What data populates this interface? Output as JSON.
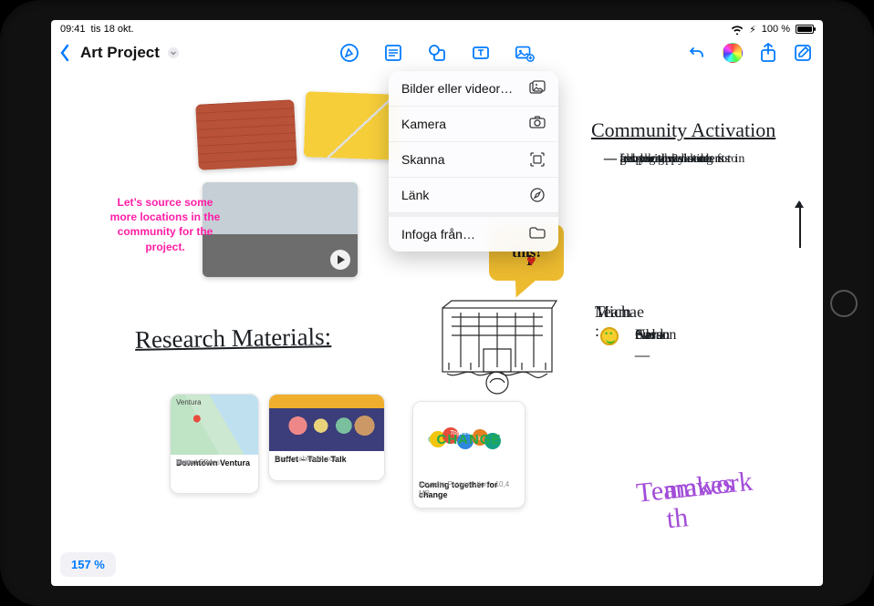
{
  "status": {
    "time": "09:41",
    "date": "tis 18 okt.",
    "battery_pct": "100 %",
    "charging_glyph": "⚡︎"
  },
  "navbar": {
    "title": "Art Project"
  },
  "insert_menu": {
    "photos": "Bilder eller videor…",
    "camera": "Kamera",
    "scan": "Skanna",
    "link": "Länk",
    "insert_from": "Infoga från…"
  },
  "canvas": {
    "pink_note": "Let’s source some more locations in the community for the project.",
    "speech": {
      "line1_prefix": "I ",
      "line2": "this!"
    },
    "research_heading": "Research Materials:",
    "community_heading": "Community Activation",
    "notes": [
      "ask local residents for in",
      "get youth volunteers to",
      "help with painting",
      "photography students",
      "from highschool",
      "for photos?"
    ],
    "team_heading": "Team :",
    "team_leader": "Michae",
    "team_members": [
      "Carson",
      "Neha",
      "Susan",
      "Aled"
    ],
    "teamwork_line1": "Teamwork",
    "teamwork_line2": "makes th",
    "card_map": {
      "title": "Downtown Ventura",
      "sub": "Ventura CA",
      "src": "United States",
      "app": "Maps",
      "pin_label": "Ventura"
    },
    "card_buffet": {
      "title": "Buffet – Table Talk",
      "sub": "joinourtabletalk.com"
    },
    "card_change": {
      "poster_top": "Coming",
      "poster_mid": "Together",
      "poster_for": "for",
      "poster_big": "CHANGE",
      "title": "Coming together for change",
      "sub": "Keynote Presentation · 10,4 MB"
    }
  },
  "zoom": {
    "label": "157 %"
  }
}
